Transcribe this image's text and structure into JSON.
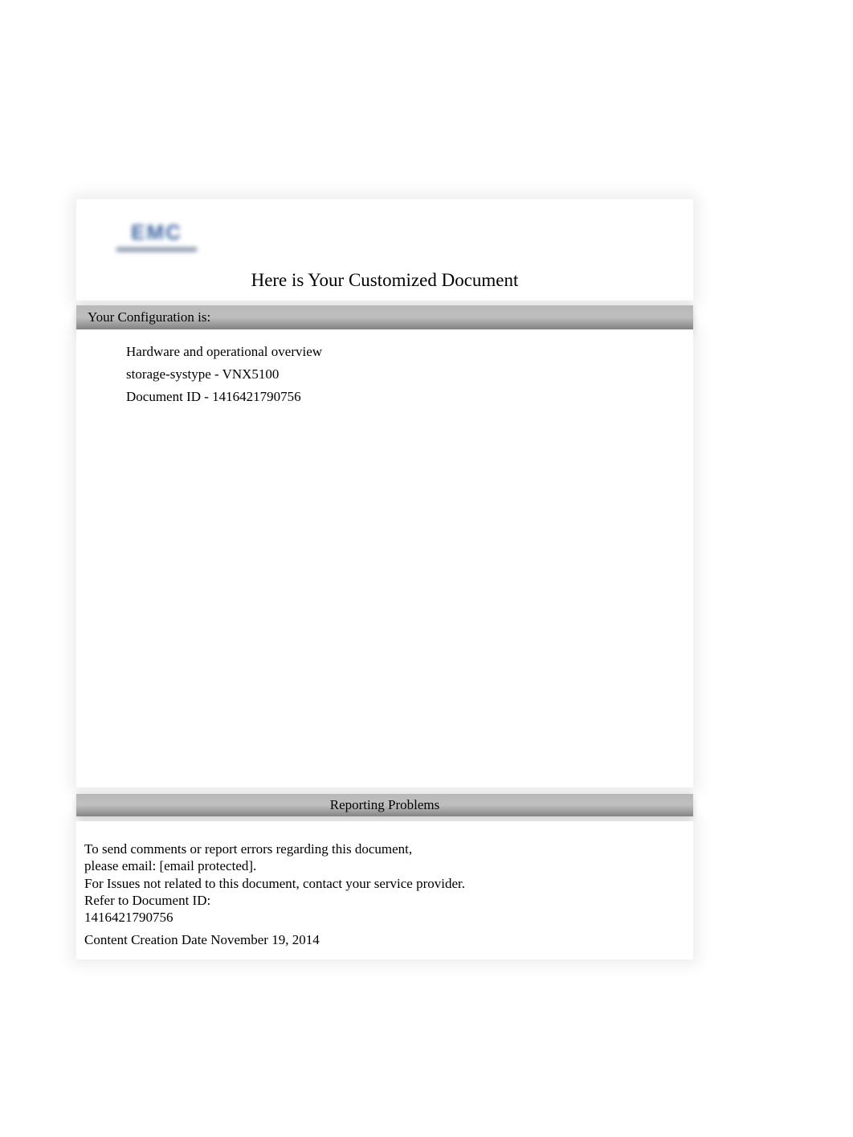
{
  "header": {
    "logo_text": "EMC",
    "title": "Here is Your Customized Document"
  },
  "config": {
    "heading": "Your Configuration is:",
    "lines": [
      "Hardware and operational overview",
      "storage-systype - VNX5100",
      "Document ID - 1416421790756"
    ]
  },
  "problems": {
    "heading": "Reporting Problems",
    "lines": [
      "To send comments or report errors regarding this document,",
      "please email: [email protected].",
      "For Issues not related to this document, contact your service provider.",
      "Refer to Document ID:",
      "1416421790756"
    ],
    "creation_date": "Content Creation Date November 19, 2014"
  }
}
